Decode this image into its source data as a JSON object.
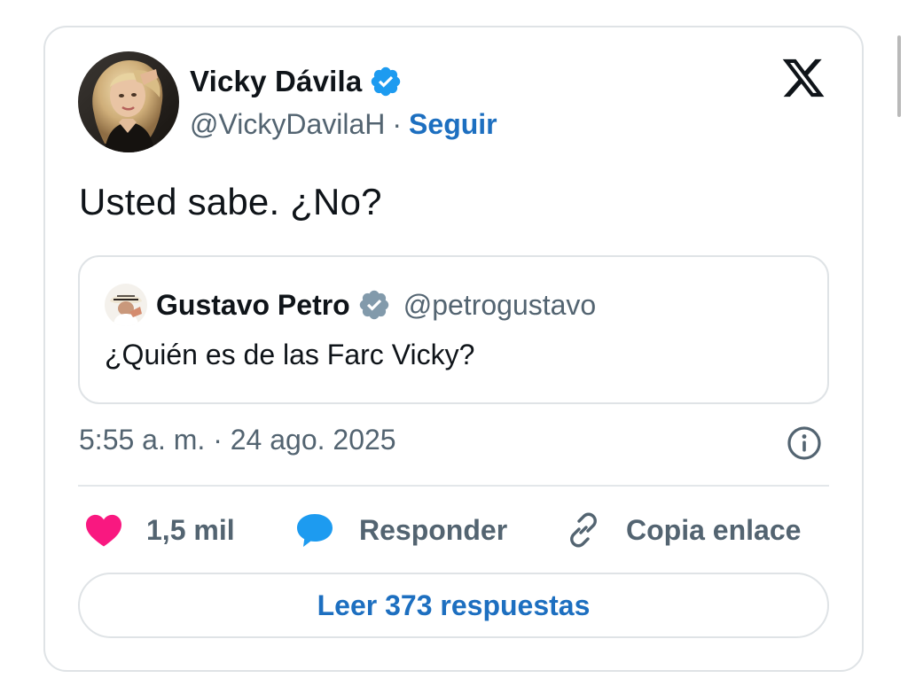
{
  "tweet": {
    "author": {
      "name": "Vicky Dávila",
      "handle": "@VickyDavilaH",
      "separator": "·",
      "follow_label": "Seguir",
      "verified": true,
      "avatar_icon": "profile-photo"
    },
    "text": "Usted sabe. ¿No?",
    "quoted": {
      "author_name": "Gustavo Petro",
      "author_handle": "@petrogustavo",
      "verified": true,
      "verified_color": "#829aab",
      "text": "¿Quién es de las Farc Vicky?"
    },
    "timestamp": "5:55 a. m. · 24 ago. 2025",
    "actions": {
      "like_count": "1,5 mil",
      "reply_label": "Responder",
      "copy_label": "Copia enlace"
    },
    "read_replies_label": "Leer 373 respuestas"
  },
  "colors": {
    "verified_blue": "#1d9bf0",
    "link_blue": "#1d6fc0",
    "like_pink": "#f91880",
    "reply_blue": "#1d9bf0",
    "secondary_text": "#536471",
    "border": "#dfe3e6"
  },
  "icons": {
    "brand": "x-logo-icon",
    "info": "info-icon",
    "like": "heart-icon",
    "reply": "speech-bubble-icon",
    "copy": "link-icon",
    "verified": "verified-badge-icon"
  }
}
